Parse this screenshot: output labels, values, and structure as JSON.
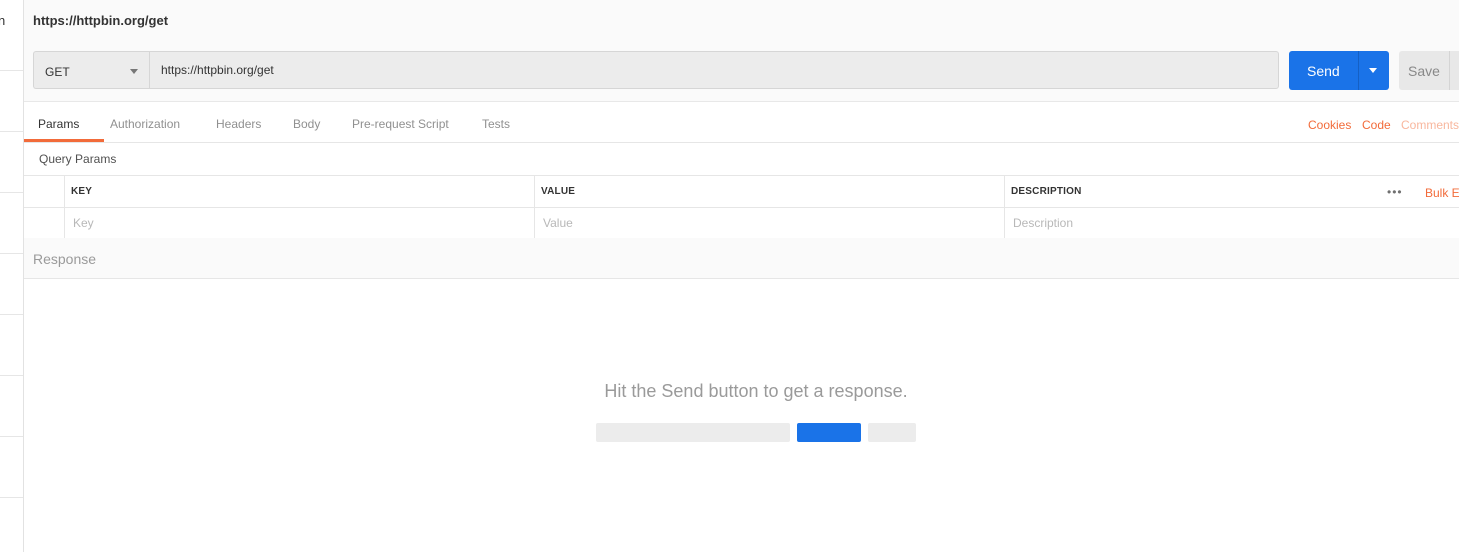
{
  "sidebar": {
    "peek_text": "n"
  },
  "header": {
    "title": "https://httpbin.org/get"
  },
  "request": {
    "method": "GET",
    "url": "https://httpbin.org/get",
    "send_label": "Send",
    "save_label": "Save"
  },
  "tabs": [
    {
      "label": "Params"
    },
    {
      "label": "Authorization"
    },
    {
      "label": "Headers"
    },
    {
      "label": "Body"
    },
    {
      "label": "Pre-request Script"
    },
    {
      "label": "Tests"
    }
  ],
  "right_links": {
    "cookies": "Cookies",
    "code": "Code",
    "comments": "Comments"
  },
  "query_params": {
    "title": "Query Params",
    "columns": {
      "key": "KEY",
      "value": "VALUE",
      "description": "DESCRIPTION"
    },
    "placeholders": {
      "key": "Key",
      "value": "Value",
      "description": "Description"
    },
    "more_label": "•••",
    "bulk_edit_label": "Bulk Edit"
  },
  "response": {
    "label": "Response",
    "empty_message": "Hit the Send button to get a response."
  },
  "colors": {
    "accent": "#f26b3a",
    "primary": "#1a73e8",
    "placeholder_gray": "#ececec"
  }
}
